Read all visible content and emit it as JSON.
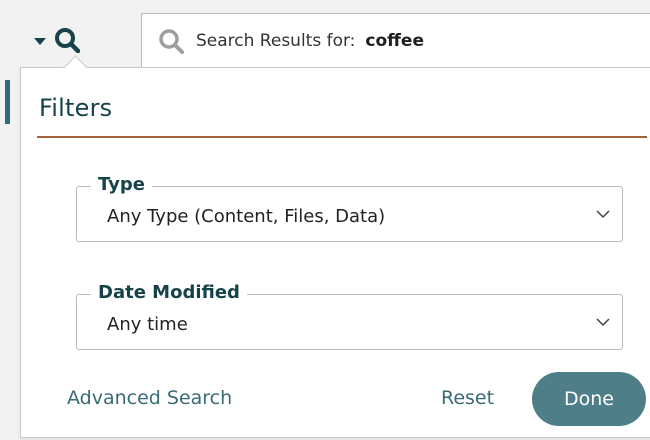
{
  "toolbar": {
    "toggle_icons": [
      "caret-down-icon",
      "search-icon"
    ]
  },
  "search": {
    "label": "Search Results for:",
    "query": "coffee"
  },
  "filters": {
    "title": "Filters",
    "type": {
      "legend": "Type",
      "value": "Any Type (Content, Files, Data)"
    },
    "date_modified": {
      "legend": "Date Modified",
      "value": "Any time"
    },
    "actions": {
      "advanced_search": "Advanced Search",
      "reset": "Reset",
      "done": "Done"
    }
  },
  "colors": {
    "primary_dark": "#16434a",
    "accent_rule": "#a0633a",
    "link": "#3a6a76",
    "done_button": "#4e7f89"
  }
}
